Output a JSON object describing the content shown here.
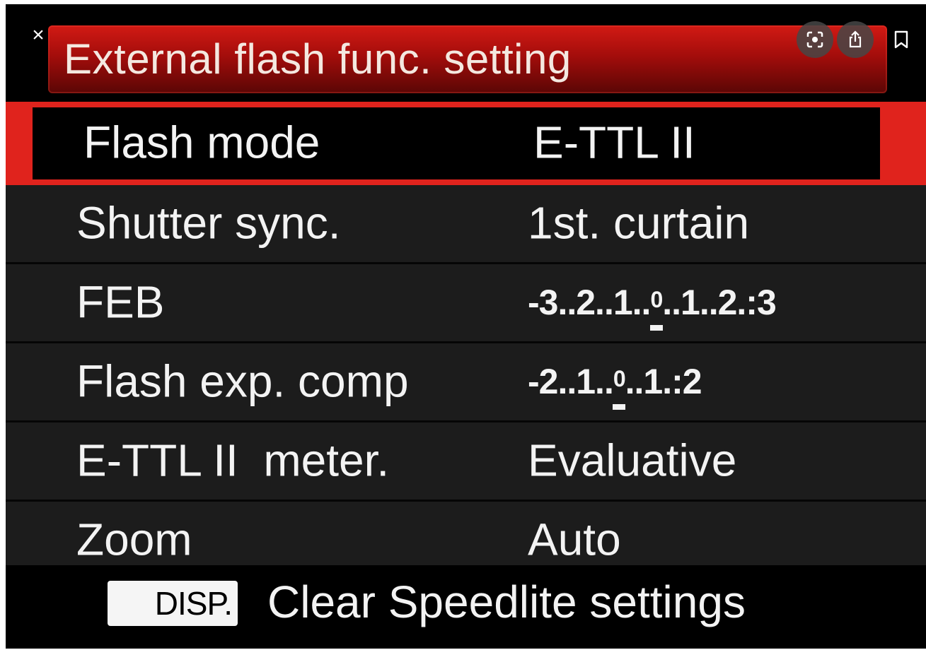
{
  "viewer": {
    "close_label": "×"
  },
  "title": "External flash func. setting",
  "menu": {
    "items": [
      {
        "label": "Flash mode",
        "value": "E-TTL II",
        "selected": true
      },
      {
        "label": "Shutter sync.",
        "value": "1st. curtain"
      },
      {
        "label": "FEB",
        "value_scale": {
          "left": "-3..2..1..",
          "center": "0",
          "right": "..1..2.:3"
        }
      },
      {
        "label": "Flash exp. comp",
        "value_scale": {
          "left": "-2..1..",
          "center": "0",
          "right": "..1.:2"
        }
      },
      {
        "label": "E-TTL II  meter.",
        "value": "Evaluative"
      },
      {
        "label": "Zoom",
        "value": "Auto"
      }
    ]
  },
  "footer": {
    "badge": "DISP.",
    "text": "Clear Speedlite settings"
  },
  "icons": {
    "lens": "lens-icon",
    "share": "share-icon",
    "bookmark": "bookmark-icon"
  },
  "colors": {
    "accent_red": "#e0231d",
    "title_red": "#b01410",
    "row_background": "#1c1c1c"
  }
}
